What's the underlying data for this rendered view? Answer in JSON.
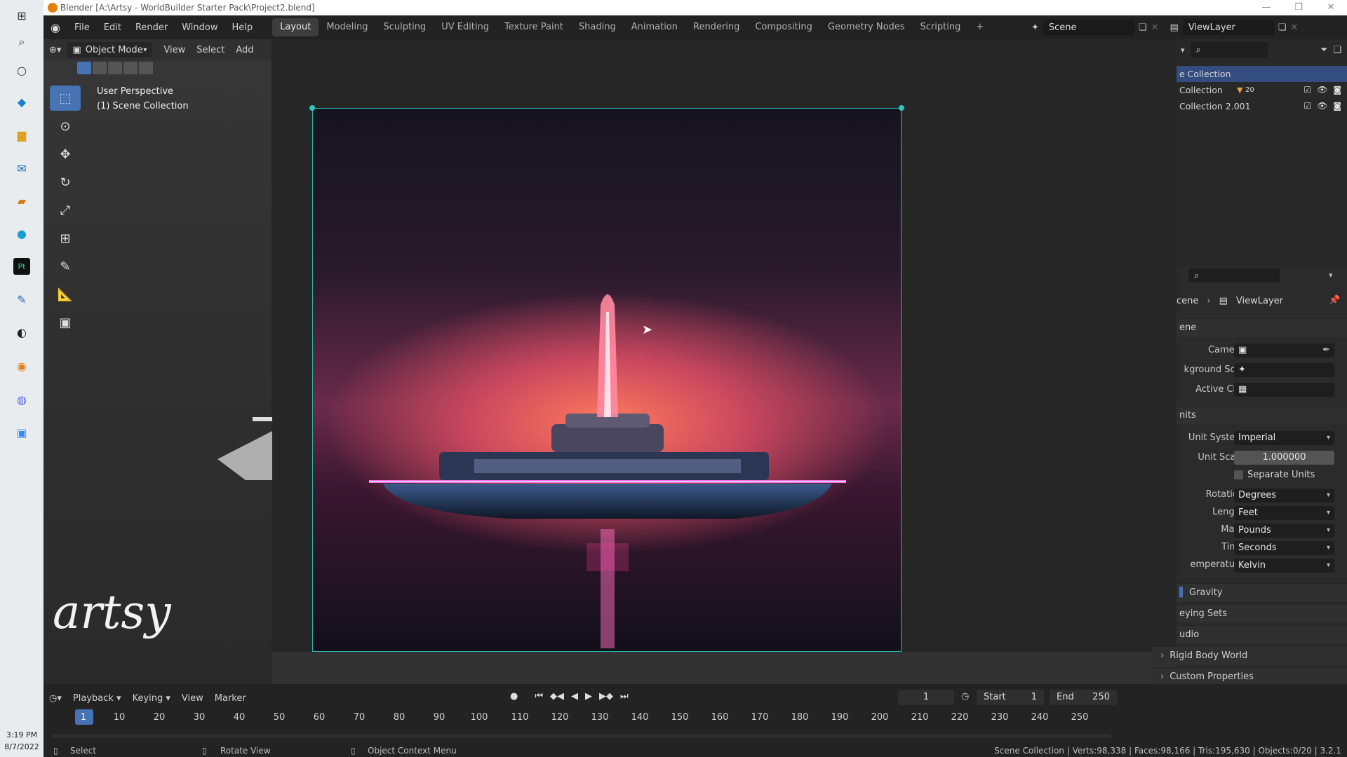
{
  "taskbar": {
    "time": "3:19 PM",
    "date": "8/7/2022"
  },
  "window": {
    "title": "Blender [A:\\Artsy - WorldBuilder Starter Pack\\Project2.blend]"
  },
  "menus": [
    "File",
    "Edit",
    "Render",
    "Window",
    "Help"
  ],
  "workspaces": [
    "Layout",
    "Modeling",
    "Sculpting",
    "UV Editing",
    "Texture Paint",
    "Shading",
    "Animation",
    "Rendering",
    "Compositing",
    "Geometry Nodes",
    "Scripting"
  ],
  "active_workspace": "Layout",
  "scene": {
    "name": "Scene",
    "view_layer": "ViewLayer"
  },
  "viewport": {
    "mode": "Object Mode",
    "header_menus": [
      "View",
      "Select",
      "Add"
    ],
    "overlay_line1": "User Perspective",
    "overlay_line2": "(1) Scene Collection",
    "watermark": "artsy"
  },
  "outliner": {
    "rows": [
      {
        "label": "e Collection",
        "selected": true
      },
      {
        "label": "Collection",
        "badge": "20",
        "selected": false
      },
      {
        "label": "Collection 2.001",
        "selected": false
      }
    ]
  },
  "properties": {
    "breadcrumb_scene": "cene",
    "breadcrumb_layer": "ViewLayer",
    "scene_section": "ene",
    "camera_label": "Camera",
    "background_label": "kground Sc...",
    "active_clip_label": "Active Clip",
    "units_section": "nits",
    "unit_system_label": "Unit System",
    "unit_system": "Imperial",
    "unit_scale_label": "Unit Scale",
    "unit_scale": "1.000000",
    "separate_units": "Separate Units",
    "rotation_label": "Rotation",
    "rotation": "Degrees",
    "length_label": "Length",
    "length": "Feet",
    "mass_label": "Mass",
    "mass": "Pounds",
    "time_label": "Time",
    "time": "Seconds",
    "temperature_label": "emperature",
    "temperature": "Kelvin",
    "sections": [
      "Gravity",
      "eying Sets",
      "udio",
      "Rigid Body World",
      "Custom Properties"
    ]
  },
  "timeline": {
    "menus": [
      "Playback",
      "Keying",
      "View",
      "Marker"
    ],
    "current_frame": "1",
    "start_label": "Start",
    "start": "1",
    "end_label": "End",
    "end": "250",
    "frame_ticks": [
      "1",
      "10",
      "20",
      "30",
      "40",
      "50",
      "60",
      "70",
      "80",
      "90",
      "100",
      "110",
      "120",
      "130",
      "140",
      "150",
      "160",
      "170",
      "180",
      "190",
      "200",
      "210",
      "220",
      "230",
      "240",
      "250"
    ]
  },
  "statusbar": {
    "select": "Select",
    "rotate": "Rotate View",
    "context": "Object Context Menu",
    "stats": "Scene Collection | Verts:98,338 | Faces:98,166 | Tris:195,630 | Objects:0/20 | 3.2.1"
  }
}
